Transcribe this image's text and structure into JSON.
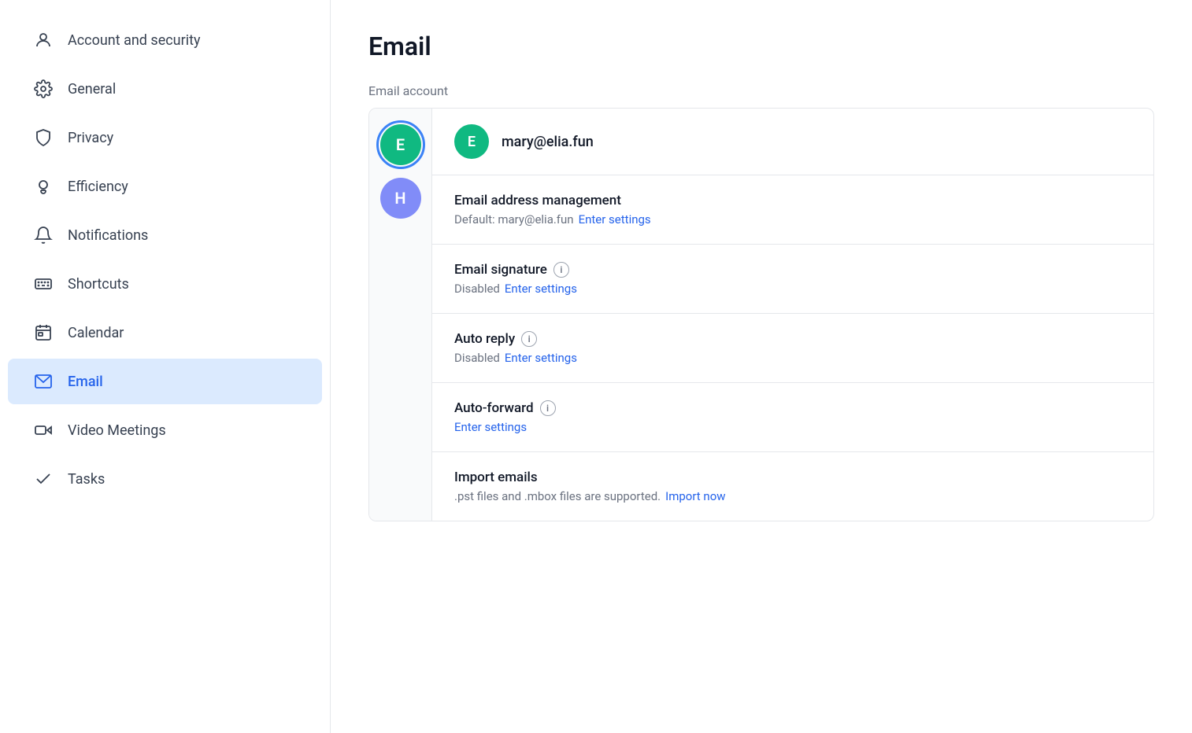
{
  "sidebar": {
    "items": [
      {
        "id": "account-security",
        "label": "Account and security",
        "icon": "person",
        "active": false
      },
      {
        "id": "general",
        "label": "General",
        "icon": "gear",
        "active": false
      },
      {
        "id": "privacy",
        "label": "Privacy",
        "icon": "shield",
        "active": false
      },
      {
        "id": "efficiency",
        "label": "Efficiency",
        "icon": "bulb",
        "active": false
      },
      {
        "id": "notifications",
        "label": "Notifications",
        "icon": "bell",
        "active": false
      },
      {
        "id": "shortcuts",
        "label": "Shortcuts",
        "icon": "keyboard",
        "active": false
      },
      {
        "id": "calendar",
        "label": "Calendar",
        "icon": "calendar",
        "active": false
      },
      {
        "id": "email",
        "label": "Email",
        "icon": "email",
        "active": true
      },
      {
        "id": "video-meetings",
        "label": "Video Meetings",
        "icon": "video",
        "active": false
      },
      {
        "id": "tasks",
        "label": "Tasks",
        "icon": "tasks",
        "active": false
      }
    ]
  },
  "main": {
    "page_title": "Email",
    "section_label": "Email account",
    "account": {
      "avatar_letter": "E",
      "email": "mary@elia.fun"
    },
    "accounts": [
      {
        "letter": "E",
        "color": "teal",
        "ring": true
      },
      {
        "letter": "H",
        "color": "purple",
        "ring": false
      }
    ],
    "settings_rows": [
      {
        "id": "email-address-management",
        "title": "Email address management",
        "sub_text": "Default: mary@elia.fun",
        "link_text": "Enter settings",
        "has_info": false
      },
      {
        "id": "email-signature",
        "title": "Email signature",
        "sub_text": "Disabled",
        "link_text": "Enter settings",
        "has_info": true
      },
      {
        "id": "auto-reply",
        "title": "Auto reply",
        "sub_text": "Disabled",
        "link_text": "Enter settings",
        "has_info": true
      },
      {
        "id": "auto-forward",
        "title": "Auto-forward",
        "sub_text": "",
        "link_text": "Enter settings",
        "has_info": true
      },
      {
        "id": "import-emails",
        "title": "Import emails",
        "sub_text": ".pst files and .mbox files are supported.",
        "link_text": "Import now",
        "has_info": false
      }
    ]
  }
}
